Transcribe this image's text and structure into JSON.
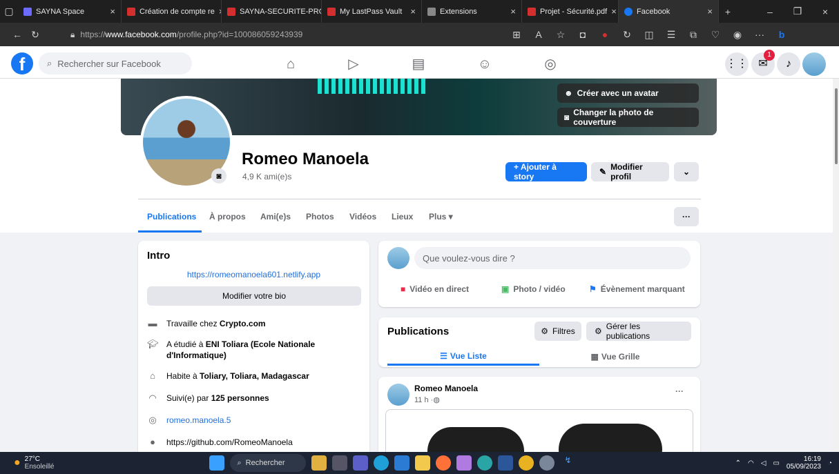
{
  "browser": {
    "tabs": [
      {
        "label": "SAYNA Space",
        "favicon_color": "#6b6bff"
      },
      {
        "label": "Création de compte re",
        "favicon_color": "#d32f2f"
      },
      {
        "label": "SAYNA-SECURITE-PRO",
        "favicon_color": "#d32f2f"
      },
      {
        "label": "My LastPass Vault",
        "favicon_color": "#d32f2f"
      },
      {
        "label": "Extensions",
        "favicon_color": "#888888"
      },
      {
        "label": "Projet - Sécurité.pdf",
        "favicon_color": "#d32f2f"
      },
      {
        "label": "Facebook",
        "favicon_color": "#1877f2"
      }
    ],
    "url_prefix": "https://",
    "url_domain": "www.facebook.com",
    "url_path": "/profile.php?id=100086059243939"
  },
  "fb": {
    "logo": "f",
    "search_placeholder": "Rechercher sur Facebook",
    "messenger_badge": "1",
    "accent": "#1877f2"
  },
  "cover": {
    "avatar_button": "Créer avec un avatar",
    "change_cover_button": "Changer la photo de couverture"
  },
  "profile": {
    "name": "Romeo Manoela",
    "friends": "4,9 K ami(e)s",
    "add_story": "+ Ajouter à story",
    "edit_profile": "Modifier profil"
  },
  "tabs": [
    "Publications",
    "À propos",
    "Ami(e)s",
    "Photos",
    "Vidéos",
    "Lieux",
    "Plus ▾"
  ],
  "intro": {
    "title": "Intro",
    "website": "https://romeomanoela601.netlify.app",
    "edit_bio": "Modifier votre bio",
    "work_prefix": "Travaille chez ",
    "work": "Crypto.com",
    "study_prefix": "A étudié à ",
    "study": "ENI Toliara (Ecole Nationale d'Informatique)",
    "live_prefix": "Habite à ",
    "live": "Toliary, Toliara, Madagascar",
    "followers_prefix": "Suivi(e) par ",
    "followers": "125 personnes",
    "instagram": "romeo.manoela.5",
    "github": "https://github.com/RomeoManoela"
  },
  "composer": {
    "placeholder": "Que voulez-vous dire ?",
    "live": "Vidéo en direct",
    "photo": "Photo / vidéo",
    "event": "Évènement marquant"
  },
  "publications": {
    "title": "Publications",
    "filters": "Filtres",
    "manage": "Gérer les publications",
    "list_view": "Vue Liste",
    "grid_view": "Vue Grille"
  },
  "post": {
    "author": "Romeo Manoela",
    "time": "11 h · ",
    "more": "···"
  },
  "taskbar": {
    "temp": "27°C",
    "weather": "Ensoleillé",
    "search": "Rechercher",
    "time": "16:19",
    "date": "05/09/2023"
  }
}
